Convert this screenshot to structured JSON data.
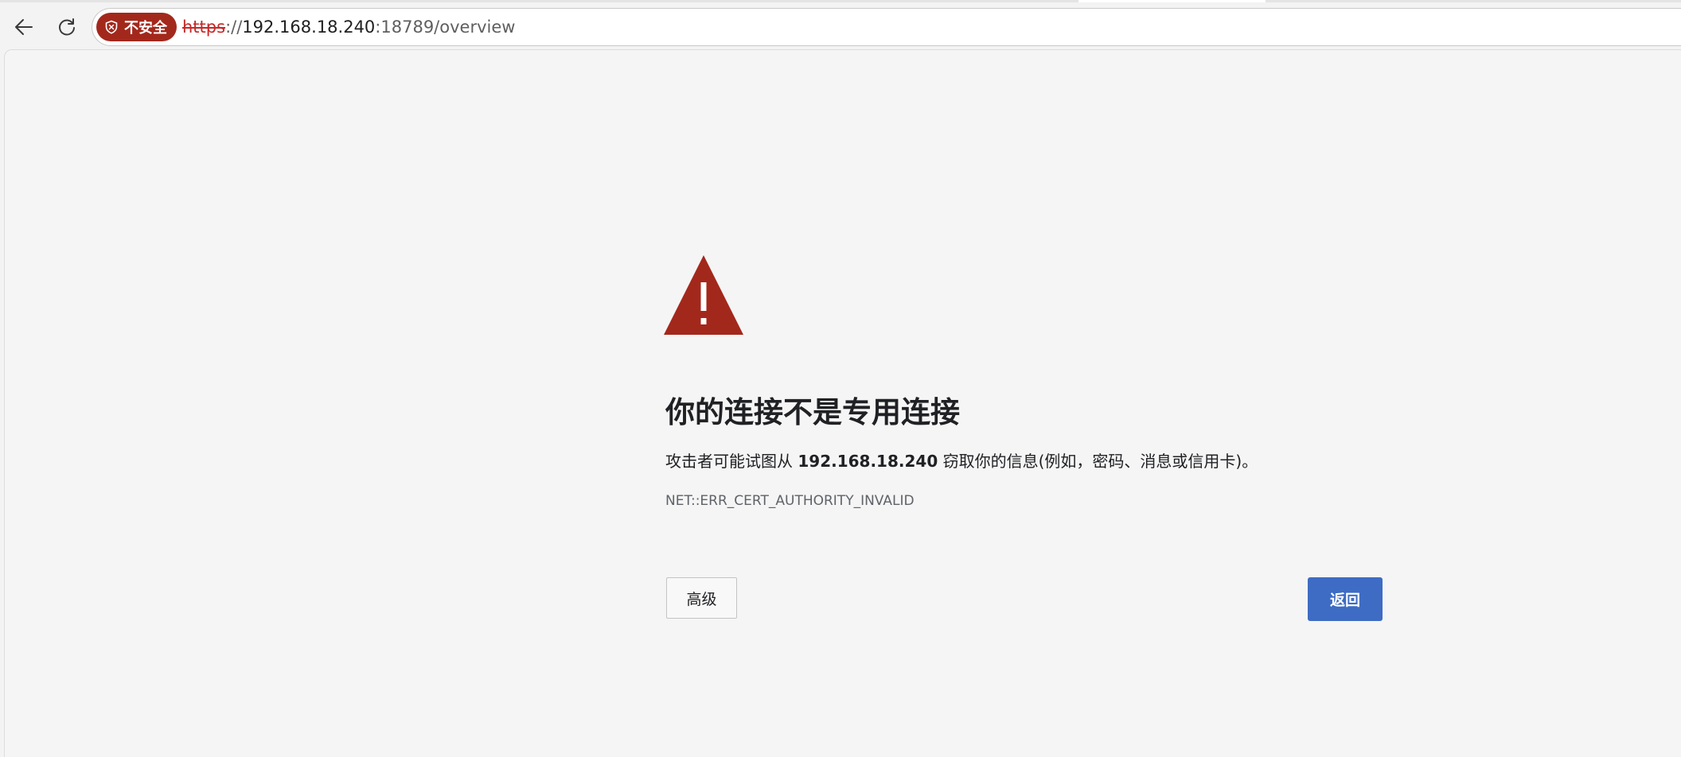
{
  "browser": {
    "security_chip_label": "不安全",
    "url": {
      "scheme": "https",
      "separator": "://",
      "host": "192.168.18.240",
      "rest": ":18789/overview"
    },
    "icons": {
      "back": "arrow-left-icon",
      "reload": "reload-icon",
      "security": "shield-warning-icon"
    }
  },
  "error_page": {
    "icon": "warning-triangle-icon",
    "headline": "你的连接不是专用连接",
    "description": {
      "prefix": "攻击者可能试图从 ",
      "host": "192.168.18.240",
      "suffix": " 窃取你的信息(例如，密码、消息或信用卡)。"
    },
    "error_code": "NET::ERR_CERT_AUTHORITY_INVALID",
    "advanced_button": "高级",
    "back_button": "返回"
  },
  "colors": {
    "danger": "#a3281c",
    "primary_button": "#3e6cc4",
    "page_background": "#f5f5f5"
  }
}
